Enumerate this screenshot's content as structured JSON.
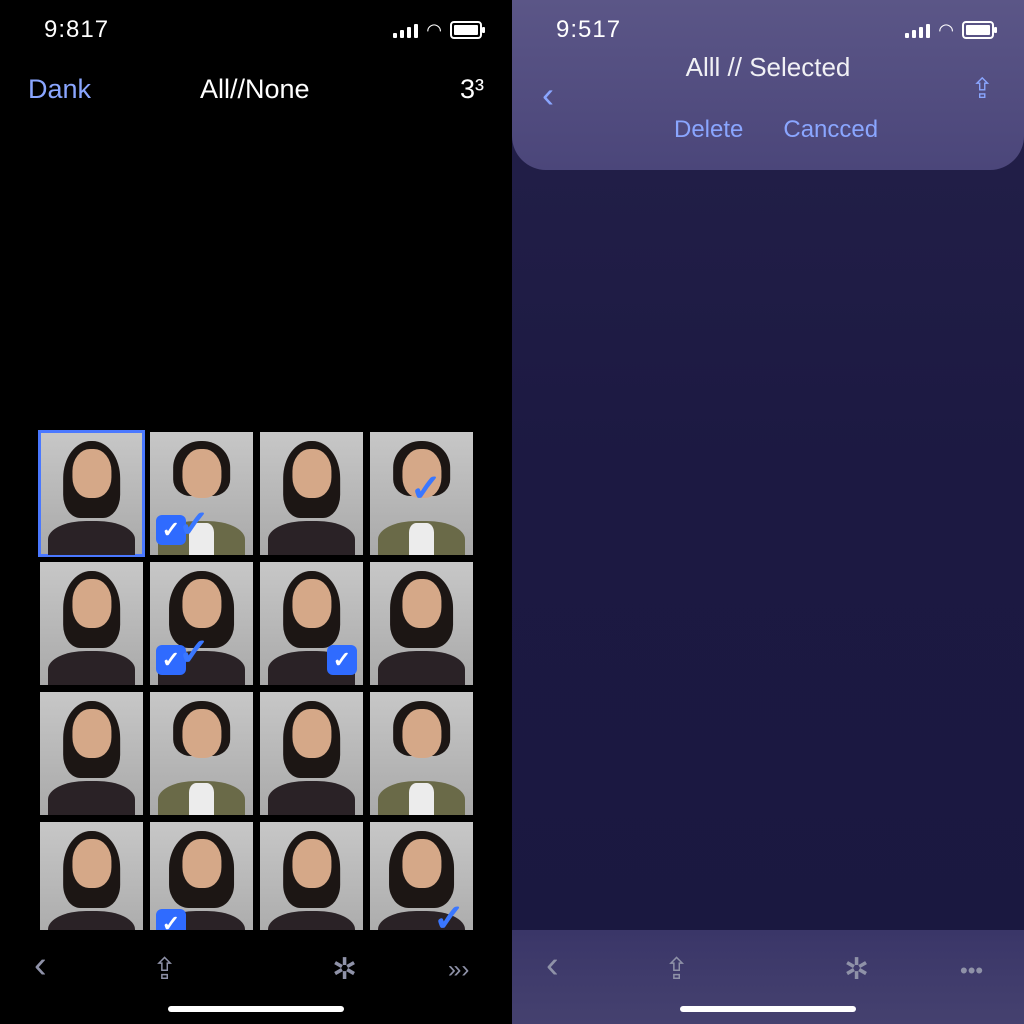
{
  "left": {
    "status": {
      "time": "9:817"
    },
    "nav": {
      "back_label": "Dank",
      "title": "All//None",
      "count": "3³"
    },
    "toolbar": {
      "back": "‹",
      "share": "⇪",
      "settings": "✲",
      "more": "»›"
    }
  },
  "right": {
    "status": {
      "time": "9:517"
    },
    "sheet": {
      "title": "Alll // Selected",
      "back": "‹",
      "share": "⇪",
      "delete_label": "Delete",
      "cancel_label": "Cancced"
    },
    "toolbar": {
      "back": "‹",
      "share": "⇪",
      "settings": "✲",
      "more": "•••"
    }
  },
  "colors": {
    "accent": "#2f6bff",
    "link": "#8aa6ff",
    "left_bg": "#000000",
    "right_bg": "#1c1942"
  }
}
